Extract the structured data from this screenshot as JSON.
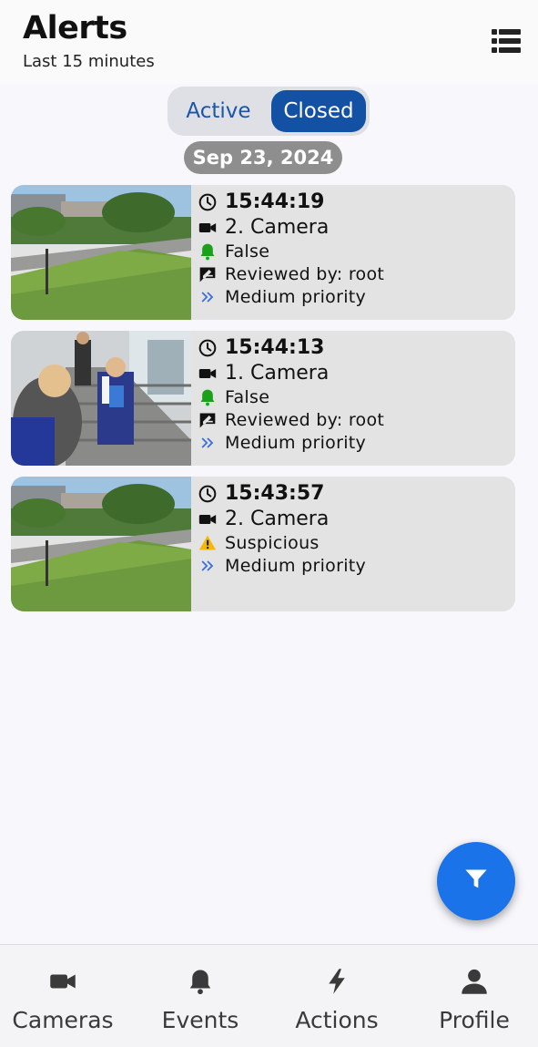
{
  "header": {
    "title": "Alerts",
    "subtitle": "Last 15 minutes",
    "menu_icon": "list-icon"
  },
  "tabs": [
    {
      "label": "Active",
      "selected": false
    },
    {
      "label": "Closed",
      "selected": true
    }
  ],
  "date_label": "Sep 23, 2024",
  "alerts": [
    {
      "thumbnail": "campus-lawn-scene",
      "time": "15:44:19",
      "camera": "2. Camera",
      "status": "False",
      "status_icon": "bell-icon",
      "status_color": "#1aa01a",
      "reviewed": "Reviewed by: root",
      "priority": "Medium priority"
    },
    {
      "thumbnail": "office-stairs-people-scene",
      "time": "15:44:13",
      "camera": "1. Camera",
      "status": "False",
      "status_icon": "bell-icon",
      "status_color": "#1aa01a",
      "reviewed": "Reviewed by: root",
      "priority": "Medium priority"
    },
    {
      "thumbnail": "campus-lawn-scene",
      "time": "15:43:57",
      "camera": "2. Camera",
      "status": "Suspicious",
      "status_icon": "warning-icon",
      "status_color": "#f5b800",
      "priority": "Medium priority"
    }
  ],
  "fab_icon": "filter-icon",
  "bottom_nav": [
    {
      "label": "Cameras",
      "icon": "video-camera-icon"
    },
    {
      "label": "Events",
      "icon": "bell-icon"
    },
    {
      "label": "Actions",
      "icon": "lightning-icon"
    },
    {
      "label": "Profile",
      "icon": "person-icon"
    }
  ],
  "colors": {
    "accent": "#1251a4",
    "fab": "#1a73e8",
    "priority_chevron": "#3b6fe0",
    "card_bg": "#e3e3e3"
  }
}
